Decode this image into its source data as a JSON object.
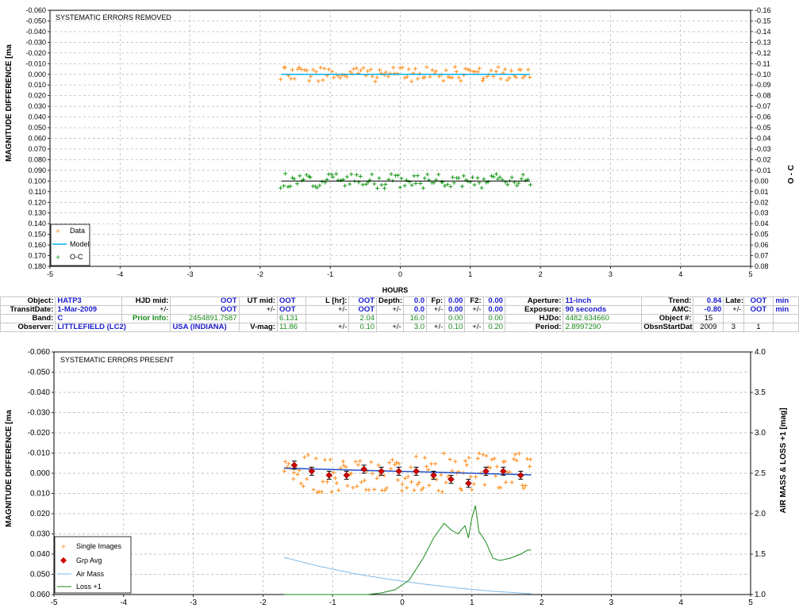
{
  "top_chart": {
    "title": "SYSTEMATIC ERRORS REMOVED",
    "ylabel_left": "MAGNITUDE DIFFERENCE [ma",
    "ylabel_right": "O - C",
    "xlabel": "HOURS",
    "x_ticks": [
      "-5",
      "-4",
      "-3",
      "-2",
      "-1",
      "0",
      "1",
      "2",
      "3",
      "4",
      "5"
    ],
    "y_left_ticks": [
      "-0.060",
      "-0.050",
      "-0.040",
      "-0.030",
      "-0.020",
      "-0.010",
      "0.000",
      "0.010",
      "0.020",
      "0.030",
      "0.040",
      "0.050",
      "0.060",
      "0.070",
      "0.080",
      "0.090",
      "0.100",
      "0.110",
      "0.120",
      "0.130",
      "0.140",
      "0.150",
      "0.160",
      "0.170",
      "0.180"
    ],
    "y_right_ticks": [
      "-0.16",
      "-0.15",
      "-0.14",
      "-0.13",
      "-0.12",
      "-0.11",
      "-0.10",
      "-0.09",
      "-0.08",
      "-0.07",
      "-0.06",
      "-0.05",
      "-0.04",
      "-0.03",
      "-0.02",
      "-0.01",
      "0.00",
      "0.01",
      "0.02",
      "0.03",
      "0.04",
      "0.05",
      "0.06",
      "0.07",
      "0.08"
    ],
    "legend": [
      "Data",
      "Model",
      "O-C"
    ]
  },
  "bottom_chart": {
    "title": "SYSTEMATIC ERRORS PRESENT",
    "ylabel_left": "MAGNITUDE DIFFERENCE [ma",
    "ylabel_right": "AIR MASS & LOSS +1 [mag]",
    "x_ticks": [
      "-5",
      "-4",
      "-3",
      "-2",
      "-1",
      "0",
      "1",
      "2",
      "3",
      "4",
      "5"
    ],
    "y_left_ticks": [
      "-0.060",
      "-0.050",
      "-0.040",
      "-0.030",
      "-0.020",
      "-0.010",
      "0.000",
      "0.010",
      "0.020",
      "0.030",
      "0.040",
      "0.050",
      "0.060"
    ],
    "y_right_ticks": [
      "4.0",
      "3.5",
      "3.0",
      "2.5",
      "2.0",
      "1.5",
      "1.0"
    ],
    "legend": [
      "Single Images",
      "Grp Avg",
      "Air Mass",
      "Loss +1"
    ]
  },
  "info": {
    "row1": {
      "object_label": "Object:",
      "object": "HATP3",
      "hjd_mid_label": "HJD mid:",
      "hjd_mid": "OOT",
      "ut_mid_label": "UT mid:",
      "ut_mid": "OOT",
      "l_hr_label": "L [hr]:",
      "l_hr": "OOT",
      "depth_label": "Depth:",
      "depth": "0.0",
      "fp_label": "Fp:",
      "fp": "0.00",
      "f2_label": "F2:",
      "f2": "0.00",
      "aperture_label": "Aperture:",
      "aperture": "11-inch",
      "trend_label": "Trend:",
      "trend": "0.84",
      "late_label": "Late:",
      "late": "OOT",
      "late_unit": "min"
    },
    "row2": {
      "transit_label": "TransitDate:",
      "transit": "1-Mar-2009",
      "pm1": "+/-",
      "v1": "OOT",
      "pm2": "+/-",
      "v2": "OOT",
      "pm3": "+/-",
      "v3": "OOT",
      "pm4": "+/-",
      "v4": "0.0",
      "pm5": "+/-",
      "v5": "0.00",
      "pm6": "+/-",
      "v6": "0.00",
      "exposure_label": "Exposure:",
      "exposure": "90 seconds",
      "amc_label": "AMC:",
      "amc": "-0.80",
      "pm7": "+/-",
      "v7": "OOT",
      "unit7": "min"
    },
    "row3": {
      "band_label": "Band:",
      "band": "C",
      "prior_label": "Prior Info:",
      "prior": "2454891.7587",
      "u1": "6.131",
      "u2": "2.04",
      "u3": "16.0",
      "u4": "0.00",
      "u5": "0.00",
      "hjdo_label": "HJDo:",
      "hjdo": "4482.634660",
      "objnum_label": "Object #:",
      "objnum": "15"
    },
    "row4": {
      "observer_label": "Observer:",
      "observer": "LITTLEFIELD (LC2)",
      "location": "USA (INDIANA)",
      "vmag_label": "V-mag:",
      "vmag": "11.86",
      "pm1": "+/-",
      "e1": "0.10",
      "pm2": "+/-",
      "e2": "3.0",
      "pm3": "+/-",
      "e3": "0.10",
      "pm4": "+/-",
      "e4": "0.20",
      "period_label": "Period:",
      "period": "2.8997290",
      "obsn_label": "ObsnStartDate:",
      "obsn_y": "2009",
      "obsn_m": "3",
      "obsn_d": "1"
    }
  },
  "colors": {
    "data": "#ff8c1a",
    "model": "#00b0f0",
    "oc": "#1a9a1a",
    "grp": "#cc0000",
    "airmass": "#7fb8e8",
    "loss": "#1a8a1a",
    "trend": "#2050c8"
  },
  "chart_data": [
    {
      "type": "scatter",
      "title": "SYSTEMATIC ERRORS REMOVED",
      "xlabel": "HOURS",
      "ylabel": "MAGNITUDE DIFFERENCE [ma",
      "xlim": [
        -5,
        5
      ],
      "ylim": [
        -0.06,
        0.18
      ],
      "y_reversed": true,
      "y2label": "O - C",
      "y2lim": [
        -0.16,
        0.08
      ],
      "grid": true,
      "legend_position": "bottom-left",
      "series": [
        {
          "name": "Data",
          "type": "scatter",
          "x_range": [
            -1.7,
            1.85
          ],
          "y_center": 0.0,
          "y_spread": 0.01
        },
        {
          "name": "Model",
          "type": "line",
          "x": [
            -1.7,
            1.85
          ],
          "y": [
            0.0,
            0.0
          ]
        },
        {
          "name": "O-C",
          "type": "scatter",
          "axis": "right",
          "x_range": [
            -1.7,
            1.85
          ],
          "y_center": 0.0,
          "y_spread": 0.01
        }
      ]
    },
    {
      "type": "scatter",
      "title": "SYSTEMATIC ERRORS PRESENT",
      "ylabel": "MAGNITUDE DIFFERENCE [ma",
      "xlim": [
        -5,
        5
      ],
      "ylim": [
        -0.06,
        0.06
      ],
      "y_reversed": true,
      "y2label": "AIR MASS & LOSS +1 [mag]",
      "y2lim": [
        1.0,
        4.0
      ],
      "grid": true,
      "legend_position": "bottom-left",
      "series": [
        {
          "name": "Single Images",
          "type": "scatter",
          "x_range": [
            -1.7,
            1.85
          ],
          "y_center": 0.0,
          "y_spread": 0.01
        },
        {
          "name": "Grp Avg",
          "type": "errorbar",
          "x": [
            -1.55,
            -1.3,
            -1.05,
            -0.8,
            -0.55,
            -0.3,
            -0.05,
            0.2,
            0.45,
            0.7,
            0.95,
            1.2,
            1.45,
            1.7
          ],
          "y": [
            -0.004,
            -0.001,
            0.001,
            0.001,
            -0.002,
            -0.001,
            -0.001,
            -0.001,
            0.001,
            0.003,
            0.005,
            -0.001,
            -0.001,
            0.001
          ],
          "err": [
            0.002,
            0.002,
            0.002,
            0.002,
            0.002,
            0.002,
            0.002,
            0.002,
            0.002,
            0.002,
            0.002,
            0.002,
            0.002,
            0.002
          ]
        },
        {
          "name": "Air Mass",
          "type": "line",
          "axis": "right",
          "x": [
            -1.7,
            -1.2,
            -0.7,
            -0.2,
            0.3,
            0.8,
            1.3,
            1.85
          ],
          "y": [
            1.46,
            1.35,
            1.26,
            1.19,
            1.13,
            1.08,
            1.04,
            1.01
          ]
        },
        {
          "name": "Loss +1",
          "type": "line",
          "axis": "right",
          "x": [
            -1.7,
            -1.4,
            -1.2,
            -0.7,
            -0.5,
            -0.3,
            -0.1,
            0.1,
            0.3,
            0.45,
            0.6,
            0.7,
            0.8,
            0.9,
            0.95,
            1.0,
            1.05,
            1.1,
            1.2,
            1.3,
            1.4,
            1.55,
            1.7,
            1.8,
            1.85
          ],
          "y": [
            1.0,
            1.0,
            1.0,
            1.0,
            1.0,
            1.02,
            1.06,
            1.18,
            1.45,
            1.7,
            1.88,
            1.8,
            1.75,
            1.85,
            1.7,
            1.95,
            2.1,
            1.78,
            1.65,
            1.45,
            1.42,
            1.45,
            1.5,
            1.55,
            1.55
          ]
        },
        {
          "name": "Trend",
          "type": "line",
          "x": [
            -1.7,
            1.85
          ],
          "y": [
            -0.0025,
            0.0008
          ]
        }
      ]
    }
  ]
}
